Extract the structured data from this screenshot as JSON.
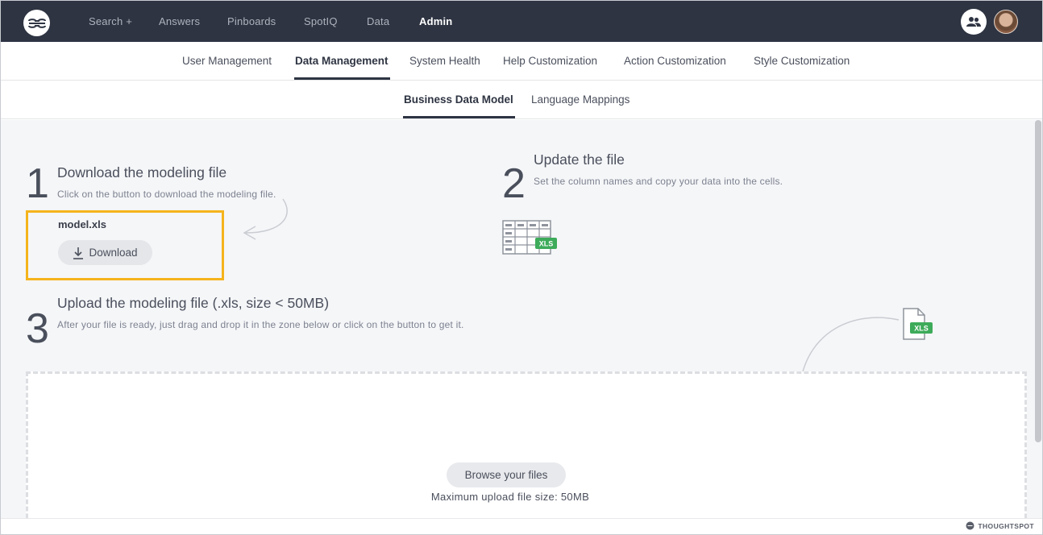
{
  "topnav": {
    "items": [
      "Search +",
      "Answers",
      "Pinboards",
      "SpotIQ",
      "Data",
      "Admin"
    ],
    "active": "Admin"
  },
  "admin_tabs": [
    "User Management",
    "Data Management",
    "System Health",
    "Help Customization",
    "Action Customization",
    "Style Customization"
  ],
  "data_tabs": [
    "Business Data Model",
    "Language Mappings"
  ],
  "step1": {
    "number": "1",
    "title": "Download the modeling file",
    "description": "Click on the button to download the modeling file.",
    "file_name": "model.xls",
    "button_label": "Download"
  },
  "step2": {
    "number": "2",
    "title": "Update the file",
    "description": "Set the column names and copy your data into the cells.",
    "badge": "XLS"
  },
  "step3": {
    "number": "3",
    "title": "Upload the modeling file (.xls, size < 50MB)",
    "description": "After your file is ready, just drag and drop it in the zone below or click on the button to get it.",
    "badge": "XLS"
  },
  "dropzone": {
    "browse_label": "Browse your files",
    "max_size_text": "Maximum upload file size: 50MB"
  },
  "footer": {
    "brand": "THOUGHTSPOT"
  },
  "colors": {
    "nav_bg": "#2e3442",
    "highlight": "#f5b41c",
    "xls_green": "#3dab5a"
  }
}
